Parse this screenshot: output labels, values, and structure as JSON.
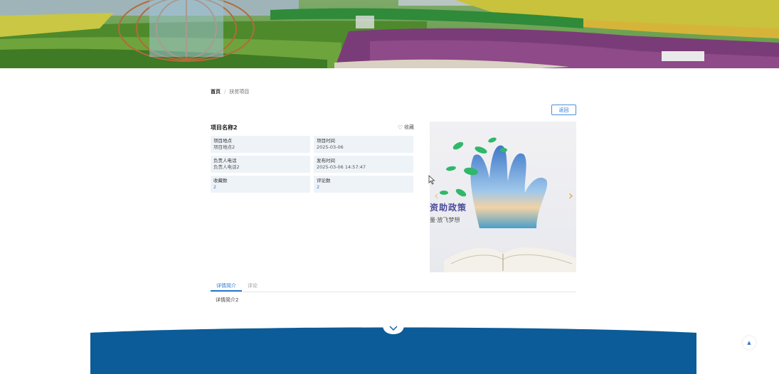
{
  "breadcrumb": {
    "home": "首页",
    "separator": "/",
    "current": "扶贫项目"
  },
  "back_button": {
    "label": "返回"
  },
  "project": {
    "name": "项目名称2",
    "favorite_label": "收藏",
    "favorite_icon": "heart-outline-icon",
    "fields": [
      {
        "label": "项目地点",
        "value": "项目地点2"
      },
      {
        "label": "项目时间",
        "value": "2025-03-06"
      },
      {
        "label": "负责人电话",
        "value": "负责人电话2"
      },
      {
        "label": "发布时间",
        "value": "2025-03-06 14:57:47"
      },
      {
        "label": "收藏数",
        "value": "2"
      },
      {
        "label": "评论数",
        "value": "2"
      }
    ]
  },
  "carousel": {
    "caption_line1": "资助政策",
    "caption_line2": "量·放飞梦想",
    "prev_icon": "chevron-left-icon",
    "next_icon": "chevron-right-icon"
  },
  "tabs": [
    {
      "label": "详情简介",
      "active": true
    },
    {
      "label": "评论",
      "active": false
    }
  ],
  "tab_content": "详情简介2",
  "colors": {
    "accent": "#2f7ad0",
    "footer": "#0b5c98",
    "cell_bg": "#eef3f8"
  },
  "icons": {
    "footer_toggle": "chevron-down-icon",
    "back_to_top": "caret-up-icon"
  }
}
